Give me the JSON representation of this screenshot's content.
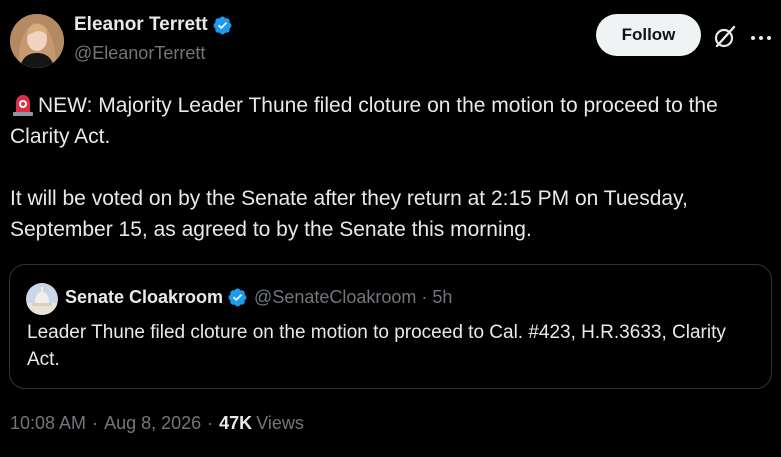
{
  "author": {
    "display_name": "Eleanor Terrett",
    "handle": "@EleanorTerrett",
    "verified": true,
    "verified_color": "#1d9bf0",
    "avatar_icon": "profile-photo"
  },
  "actions": {
    "follow_label": "Follow",
    "grok_icon": "grok-slash-circle-icon",
    "more_icon": "more-horizontal-icon"
  },
  "tweet": {
    "emoji": "rotating-light-siren",
    "paragraph1": "NEW: Majority Leader Thune filed cloture on the motion to proceed to the Clarity Act.",
    "paragraph2": "It will be voted on by the Senate after they return at 2:15 PM on Tuesday, September 15, as agreed to by the Senate this morning."
  },
  "quote": {
    "display_name": "Senate Cloakroom",
    "handle": "@SenateCloakroom",
    "dot": "·",
    "time": "5h",
    "verified": true,
    "text": "Leader Thune filed cloture on the motion to proceed to Cal. #423, H.R.3633, Clarity Act."
  },
  "meta": {
    "time": "10:08 AM",
    "dot1": "·",
    "date": "Aug 8, 2026",
    "dot2": "·",
    "views_count": "47K",
    "views_label": "Views"
  },
  "colors": {
    "background": "#000000",
    "text_primary": "#e7e9ea",
    "text_secondary": "#71767b",
    "border": "#2f3336",
    "follow_bg": "#eff3f4"
  }
}
